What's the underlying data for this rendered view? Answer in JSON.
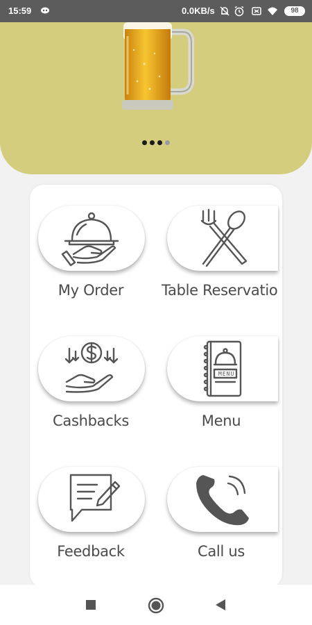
{
  "status_bar": {
    "time": "15:59",
    "network_speed": "0.0KB/s",
    "battery": "98",
    "icons": [
      "notification-icon",
      "bell-off-icon",
      "alarm-icon",
      "sim-icon",
      "wifi-icon",
      "battery-icon"
    ]
  },
  "banner": {
    "image": "beer-mug",
    "background_color": "#d4cd7e",
    "carousel_dots": 4,
    "active_dots": 3
  },
  "menu_tiles": [
    {
      "label": "My Order",
      "icon": "serving-cloche-icon"
    },
    {
      "label": "Table Reservatio",
      "icon": "fork-spoon-icon"
    },
    {
      "label": "Cashbacks",
      "icon": "cashback-hand-icon"
    },
    {
      "label": "Menu",
      "icon": "menu-book-icon"
    },
    {
      "label": "Feedback",
      "icon": "feedback-note-icon"
    },
    {
      "label": "Call us",
      "icon": "phone-call-icon"
    }
  ],
  "nav_bar": {
    "buttons": [
      "recents-square-icon",
      "home-circle-icon",
      "back-triangle-icon"
    ]
  },
  "colors": {
    "banner": "#d4cd7e",
    "status_bar": "#5c5c5c",
    "icon_stroke": "#555555",
    "label_text": "#4a4a4a"
  }
}
